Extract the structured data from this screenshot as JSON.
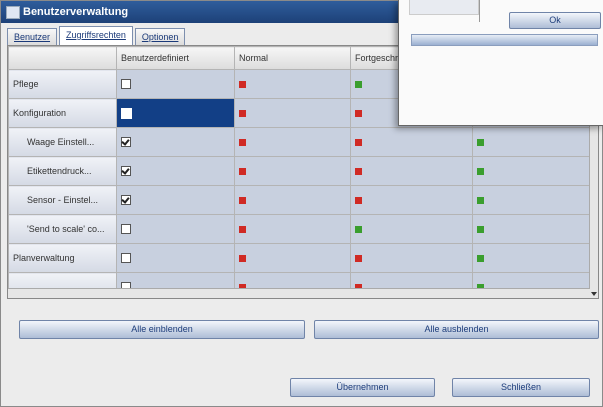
{
  "window": {
    "title": "Benutzerverwaltung"
  },
  "tabs": [
    {
      "label": "Benutzer",
      "active": false
    },
    {
      "label": "Zugriffsrechten",
      "active": true
    },
    {
      "label": "Optionen",
      "active": false
    }
  ],
  "table": {
    "columns": [
      "",
      "Benutzerdefiniert",
      "Normal",
      "Fortgeschritten",
      ""
    ],
    "rows": [
      {
        "label": "Pflege",
        "custom": false,
        "normal": "red",
        "advanced": "green",
        "expert": ""
      },
      {
        "label": "Konfiguration",
        "custom": false,
        "selected": true,
        "normal": "red",
        "advanced": "red",
        "expert": "green"
      },
      {
        "label": "Waage Einstell...",
        "custom": true,
        "normal": "red",
        "advanced": "red",
        "expert": "green"
      },
      {
        "label": "Etikettendruck...",
        "custom": true,
        "normal": "red",
        "advanced": "red",
        "expert": "green"
      },
      {
        "label": "Sensor - Einstel...",
        "custom": true,
        "normal": "red",
        "advanced": "red",
        "expert": "green"
      },
      {
        "label": "'Send to scale' co...",
        "custom": false,
        "normal": "red",
        "advanced": "green",
        "expert": "green"
      },
      {
        "label": "Planverwaltung",
        "custom": false,
        "normal": "red",
        "advanced": "red",
        "expert": "green"
      },
      {
        "label": "",
        "custom": false,
        "normal": "red",
        "advanced": "red",
        "expert": "green"
      }
    ]
  },
  "buttons": {
    "enable_all": "Alle einblenden",
    "disable_all": "Alle ausblenden",
    "apply": "Übernehmen",
    "close": "Schließen"
  },
  "popup": {
    "ok_label": "Ok"
  },
  "colors": {
    "title_bar": "#1d4178",
    "selection": "#123f86",
    "red_mark": "#d02a24",
    "green_mark": "#3a9e2e"
  }
}
